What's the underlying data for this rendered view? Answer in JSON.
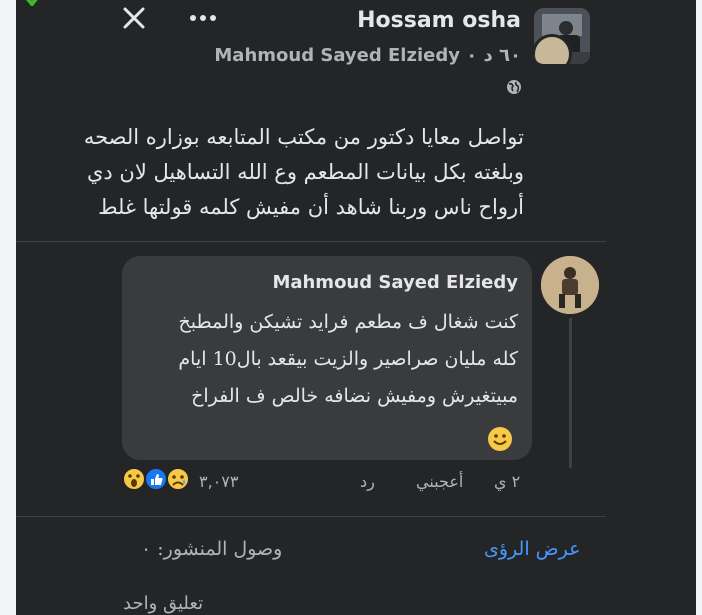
{
  "post": {
    "author": "Hossam osha",
    "meta_prefix": "Mahmoud Sayed Elziedy",
    "meta_time": "۰ ٦٠ د",
    "text_lines": [
      "تواصل معايا دكتور من مكتب المتابعه بوزاره الصحه",
      "وبلغته بكل بيانات المطعم وع الله التساهيل لان دي",
      "أرواح ناس وربنا شاهد أن مفيش كلمه قولتها غلط"
    ]
  },
  "comment": {
    "author": "Mahmoud Sayed Elziedy",
    "text_lines": [
      "كنت شغال ف مطعم فرايد تشيكن والمطبخ",
      "كله مليان صراصير والزيت بيقعد بال10 ايام",
      "مبيتغيرش ومفيش نضافه خالص ف الفراخ"
    ],
    "time": "٢ ي",
    "like_label": "أعجبني",
    "reply_label": "رد",
    "reaction_count": "٣,٠٧٣"
  },
  "footer": {
    "insights_label": "عرض الرؤى",
    "reach_label": "وصول المنشور: ٠",
    "comment_count_label": "تعليق واحد"
  },
  "colors": {
    "background": "#242526",
    "bubble": "#3a3b3c",
    "link": "#4599ff",
    "secondary_text": "#b0b3b8"
  }
}
